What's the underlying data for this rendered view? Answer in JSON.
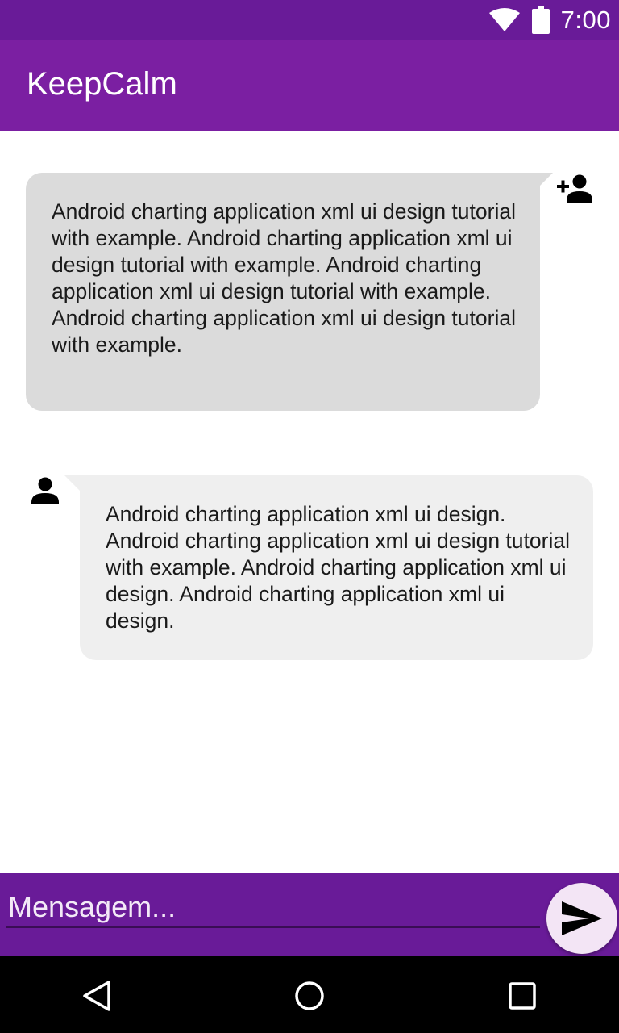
{
  "status_bar": {
    "time": "7:00",
    "icons": [
      "wifi-icon",
      "battery-icon"
    ]
  },
  "app_bar": {
    "title": "KeepCalm",
    "color": "#7b1fa2"
  },
  "messages": [
    {
      "direction": "incoming",
      "avatar_icon": "person-add-icon",
      "text": "Android charting application xml ui design tutorial with example. Android charting application xml ui design tutorial with example. Android charting application xml ui design tutorial with example. Android charting application xml ui design tutorial with example.",
      "bubble_color": "#dbdbdb"
    },
    {
      "direction": "outgoing",
      "avatar_icon": "person-icon",
      "text": "Android charting application xml ui design. Android charting application xml ui design tutorial with example. Android charting application xml ui design. Android charting application xml ui design.",
      "bubble_color": "#efefef"
    }
  ],
  "composer": {
    "placeholder": "Mensagem...",
    "value": "",
    "send_icon": "send-icon",
    "bar_color": "#691b98"
  },
  "nav_bar": {
    "buttons": [
      "back-icon",
      "home-icon",
      "recents-icon"
    ]
  }
}
